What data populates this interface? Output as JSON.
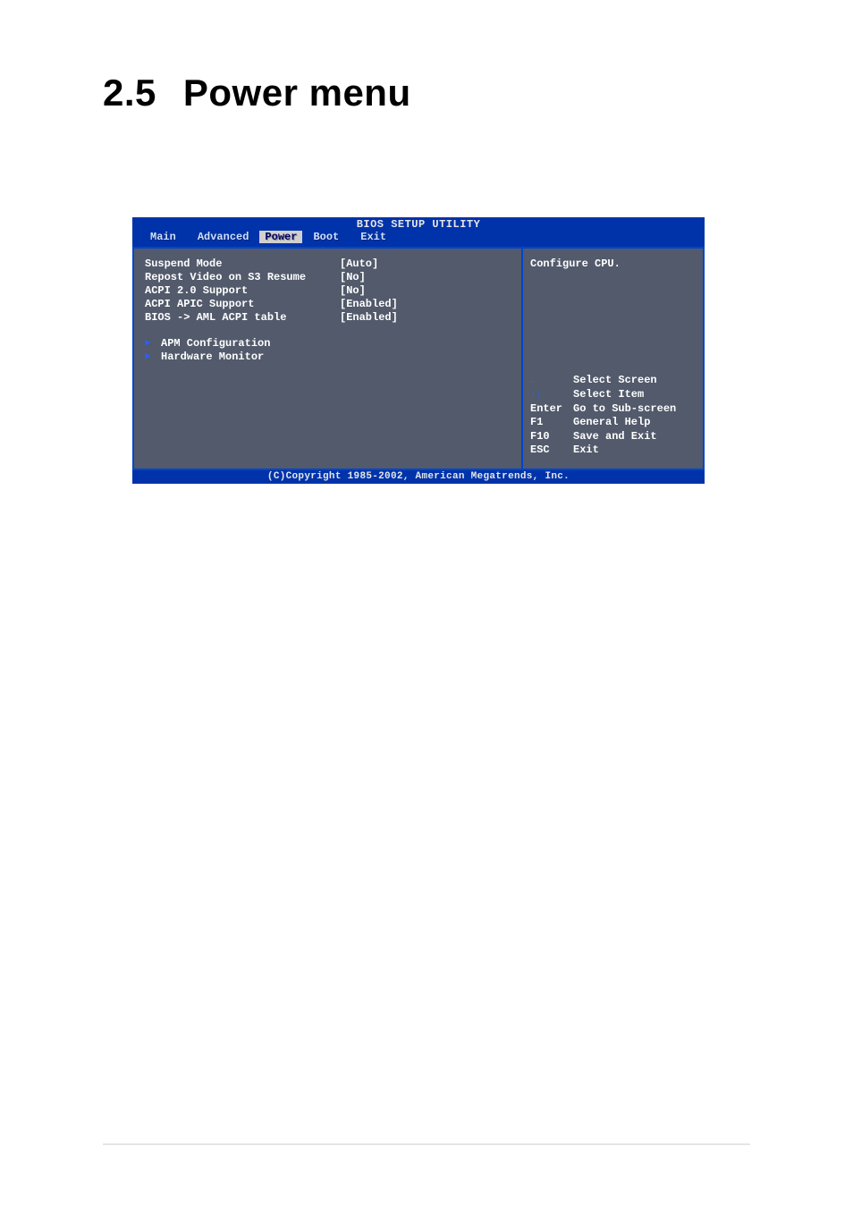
{
  "heading": {
    "number": "2.5",
    "title": "Power menu"
  },
  "bios": {
    "title": "BIOS SETUP UTILITY",
    "tabs": [
      {
        "label": "Main"
      },
      {
        "label": "Advanced"
      },
      {
        "label": "Power"
      },
      {
        "label": "Boot"
      },
      {
        "label": "Exit"
      }
    ],
    "active_tab_index": 2,
    "settings": [
      {
        "label": "Suspend Mode",
        "value": "[Auto]"
      },
      {
        "label": "Repost Video on S3 Resume",
        "value": "[No]"
      },
      {
        "label": "ACPI 2.0 Support",
        "value": "[No]"
      },
      {
        "label": "ACPI APIC Support",
        "value": "[Enabled]"
      },
      {
        "label": "BIOS -> AML ACPI table",
        "value": "[Enabled]"
      }
    ],
    "submenus": [
      {
        "label": "APM Configuration"
      },
      {
        "label": "Hardware Monitor"
      }
    ],
    "help_text": "Configure CPU.",
    "nav": [
      {
        "key_icon": "←",
        "key": "",
        "action": "Select Screen"
      },
      {
        "key_icon": "↑↓",
        "key": "",
        "action": "Select Item"
      },
      {
        "key_icon": "",
        "key": "Enter",
        "action": "Go to Sub-screen"
      },
      {
        "key_icon": "",
        "key": "F1",
        "action": "General Help"
      },
      {
        "key_icon": "",
        "key": "F10",
        "action": "Save and Exit"
      },
      {
        "key_icon": "",
        "key": "ESC",
        "action": "Exit"
      }
    ],
    "footer": "(C)Copyright 1985-2002, American Megatrends, Inc."
  }
}
